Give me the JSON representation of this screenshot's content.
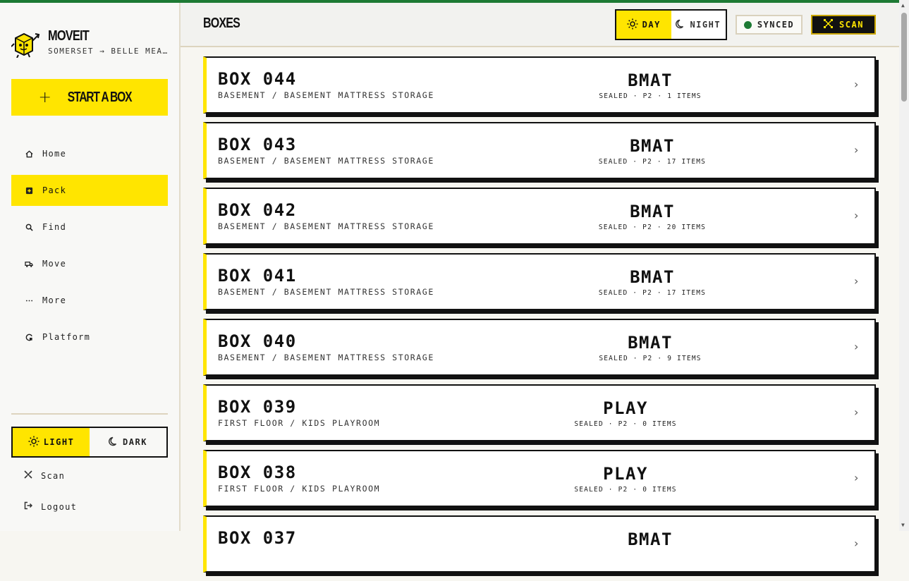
{
  "app": {
    "name": "MOVEIT",
    "subtitle": "SOMERSET → BELLE MEADE"
  },
  "sidebar": {
    "start_label": "START A BOX",
    "nav": [
      {
        "label": "Home",
        "icon": "home-icon",
        "active": false
      },
      {
        "label": "Pack",
        "icon": "plus-square-icon",
        "active": true
      },
      {
        "label": "Find",
        "icon": "search-icon",
        "active": false
      },
      {
        "label": "Move",
        "icon": "truck-icon",
        "active": false
      },
      {
        "label": "More",
        "icon": "ellipsis-icon",
        "active": false
      },
      {
        "label": "Platform",
        "icon": "platform-icon",
        "active": false
      }
    ],
    "theme": {
      "light": "LIGHT",
      "dark": "DARK",
      "selected": "LIGHT"
    },
    "scan_label": "Scan",
    "logout_label": "Logout"
  },
  "header": {
    "title": "BOXES",
    "day_label": "DAY",
    "night_label": "NIGHT",
    "selected_mode": "DAY",
    "sync_label": "SYNCED",
    "scan_label": "SCAN"
  },
  "colors": {
    "accent": "#ffe500",
    "synced": "#1d7a34",
    "ink": "#111111"
  },
  "boxes": [
    {
      "number": "BOX 044",
      "location": "BASEMENT / BASEMENT MATTRESS STORAGE",
      "code": "BMAT",
      "meta": "SEALED · P2 · 1 ITEMS"
    },
    {
      "number": "BOX 043",
      "location": "BASEMENT / BASEMENT MATTRESS STORAGE",
      "code": "BMAT",
      "meta": "SEALED · P2 · 17 ITEMS"
    },
    {
      "number": "BOX 042",
      "location": "BASEMENT / BASEMENT MATTRESS STORAGE",
      "code": "BMAT",
      "meta": "SEALED · P2 · 20 ITEMS"
    },
    {
      "number": "BOX 041",
      "location": "BASEMENT / BASEMENT MATTRESS STORAGE",
      "code": "BMAT",
      "meta": "SEALED · P2 · 17 ITEMS"
    },
    {
      "number": "BOX 040",
      "location": "BASEMENT / BASEMENT MATTRESS STORAGE",
      "code": "BMAT",
      "meta": "SEALED · P2 · 9 ITEMS"
    },
    {
      "number": "BOX 039",
      "location": "FIRST FLOOR / KIDS PLAYROOM",
      "code": "PLAY",
      "meta": "SEALED · P2 · 0 ITEMS"
    },
    {
      "number": "BOX 038",
      "location": "FIRST FLOOR / KIDS PLAYROOM",
      "code": "PLAY",
      "meta": "SEALED · P2 · 0 ITEMS"
    },
    {
      "number": "BOX 037",
      "location": "",
      "code": "BMAT",
      "meta": ""
    }
  ]
}
